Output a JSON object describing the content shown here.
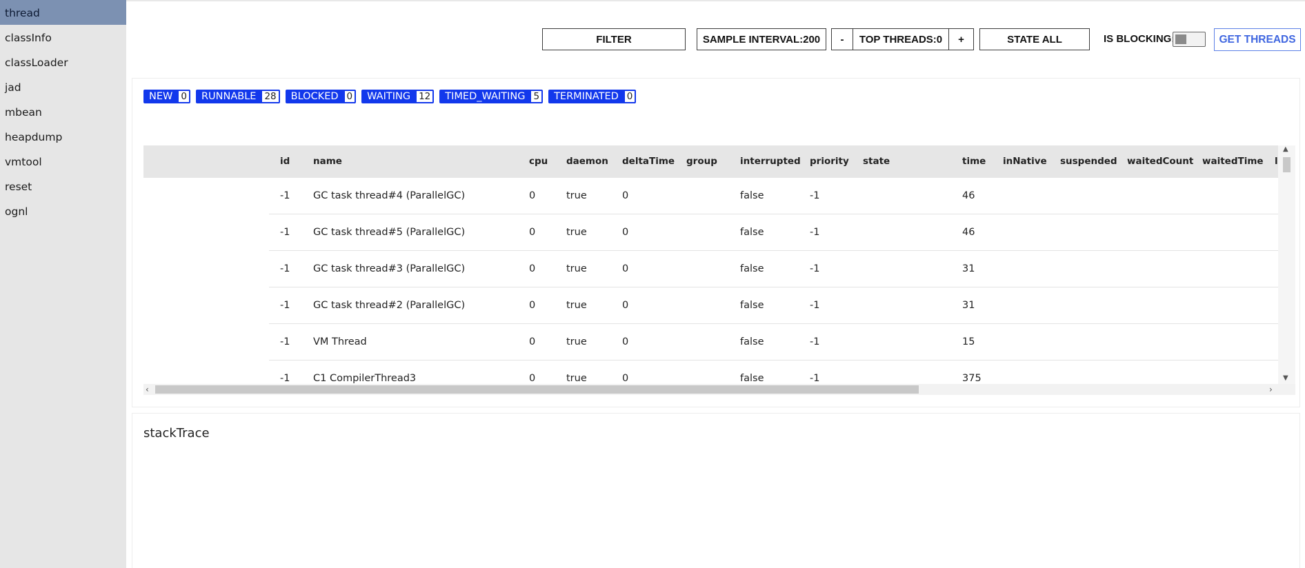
{
  "sidebar": {
    "items": [
      {
        "label": "thread",
        "active": true
      },
      {
        "label": "classInfo"
      },
      {
        "label": "classLoader"
      },
      {
        "label": "jad"
      },
      {
        "label": "mbean"
      },
      {
        "label": "heapdump"
      },
      {
        "label": "vmtool"
      },
      {
        "label": "reset"
      },
      {
        "label": "ognl"
      }
    ]
  },
  "toolbar": {
    "filter_label": "FILTER",
    "sample_interval_label": "SAMPLE INTERVAL:200",
    "minus_label": "-",
    "top_threads_label": "TOP THREADS:0",
    "plus_label": "+",
    "state_label": "STATE ALL",
    "blocking_label": "IS BLOCKING:",
    "get_threads_label": "GET THREADS"
  },
  "states": [
    {
      "label": "NEW",
      "count": "0"
    },
    {
      "label": "RUNNABLE",
      "count": "28"
    },
    {
      "label": "BLOCKED",
      "count": "0"
    },
    {
      "label": "WAITING",
      "count": "12"
    },
    {
      "label": "TIMED_WAITING",
      "count": "5"
    },
    {
      "label": "TERMINATED",
      "count": "0"
    }
  ],
  "table": {
    "headers": [
      "id",
      "name",
      "cpu",
      "daemon",
      "deltaTime",
      "group",
      "interrupted",
      "priority",
      "state",
      "time",
      "inNative",
      "suspended",
      "waitedCount",
      "waitedTime",
      "l"
    ],
    "rows": [
      {
        "id": "-1",
        "name": "GC task thread#4 (ParallelGC)",
        "cpu": "0",
        "daemon": "true",
        "deltaTime": "0",
        "interrupted": "false",
        "priority": "-1",
        "time": "46"
      },
      {
        "id": "-1",
        "name": "GC task thread#5 (ParallelGC)",
        "cpu": "0",
        "daemon": "true",
        "deltaTime": "0",
        "interrupted": "false",
        "priority": "-1",
        "time": "46"
      },
      {
        "id": "-1",
        "name": "GC task thread#3 (ParallelGC)",
        "cpu": "0",
        "daemon": "true",
        "deltaTime": "0",
        "interrupted": "false",
        "priority": "-1",
        "time": "31"
      },
      {
        "id": "-1",
        "name": "GC task thread#2 (ParallelGC)",
        "cpu": "0",
        "daemon": "true",
        "deltaTime": "0",
        "interrupted": "false",
        "priority": "-1",
        "time": "31"
      },
      {
        "id": "-1",
        "name": "VM Thread",
        "cpu": "0",
        "daemon": "true",
        "deltaTime": "0",
        "interrupted": "false",
        "priority": "-1",
        "time": "15"
      },
      {
        "id": "-1",
        "name": "C1 CompilerThread3",
        "cpu": "0",
        "daemon": "true",
        "deltaTime": "0",
        "interrupted": "false",
        "priority": "-1",
        "time": "375"
      }
    ]
  },
  "stack": {
    "title": "stackTrace"
  },
  "colors": {
    "sidebar_active": "#7c91b2",
    "badge": "#1238ec",
    "get_threads": "#3f66e0"
  }
}
